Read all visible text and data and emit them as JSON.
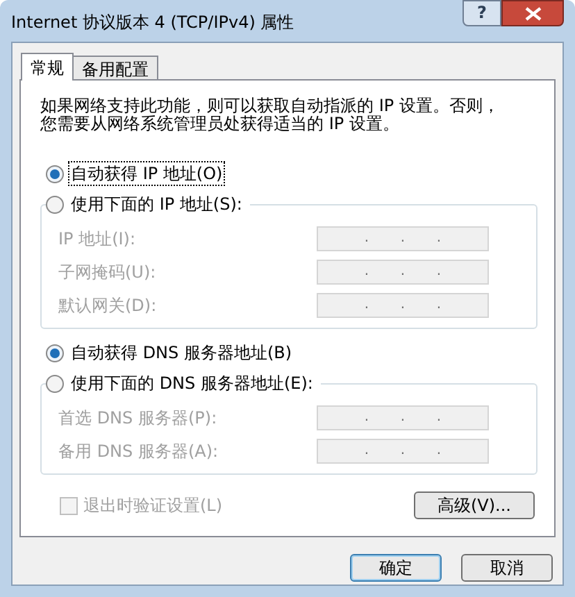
{
  "window": {
    "title": "Internet 协议版本 4 (TCP/IPv4) 属性",
    "help_button": "?"
  },
  "tabs": [
    {
      "label": "常规",
      "selected": true
    },
    {
      "label": "备用配置",
      "selected": false
    }
  ],
  "description_lines": [
    "如果网络支持此功能，则可以获取自动指派的 IP 设置。否则，",
    "您需要从网络系统管理员处获得适当的 IP 设置。"
  ],
  "ip_section": {
    "auto_option": {
      "label": "自动获得 IP 地址(O)",
      "selected": true,
      "focused": true
    },
    "manual_option": {
      "label": "使用下面的 IP 地址(S):",
      "selected": false,
      "focused": false
    },
    "fields": [
      {
        "label": "IP 地址(I):",
        "disabled": true,
        "dots": [
          ".",
          ".",
          "."
        ]
      },
      {
        "label": "子网掩码(U):",
        "disabled": true,
        "dots": [
          ".",
          ".",
          "."
        ]
      },
      {
        "label": "默认网关(D):",
        "disabled": true,
        "dots": [
          ".",
          ".",
          "."
        ]
      }
    ]
  },
  "dns_section": {
    "auto_option": {
      "label": "自动获得 DNS 服务器地址(B)",
      "selected": true,
      "focused": false
    },
    "manual_option": {
      "label": "使用下面的 DNS 服务器地址(E):",
      "selected": false,
      "focused": false
    },
    "fields": [
      {
        "label": "首选 DNS 服务器(P):",
        "disabled": true,
        "dots": [
          ".",
          ".",
          "."
        ]
      },
      {
        "label": "备用 DNS 服务器(A):",
        "disabled": true,
        "dots": [
          ".",
          ".",
          "."
        ]
      }
    ]
  },
  "validate_checkbox": {
    "label": "退出时验证设置(L)",
    "checked": false,
    "disabled": true
  },
  "advanced_button": "高级(V)...",
  "buttons": [
    {
      "label": "确定",
      "default": true
    },
    {
      "label": "取消",
      "default": false
    }
  ]
}
